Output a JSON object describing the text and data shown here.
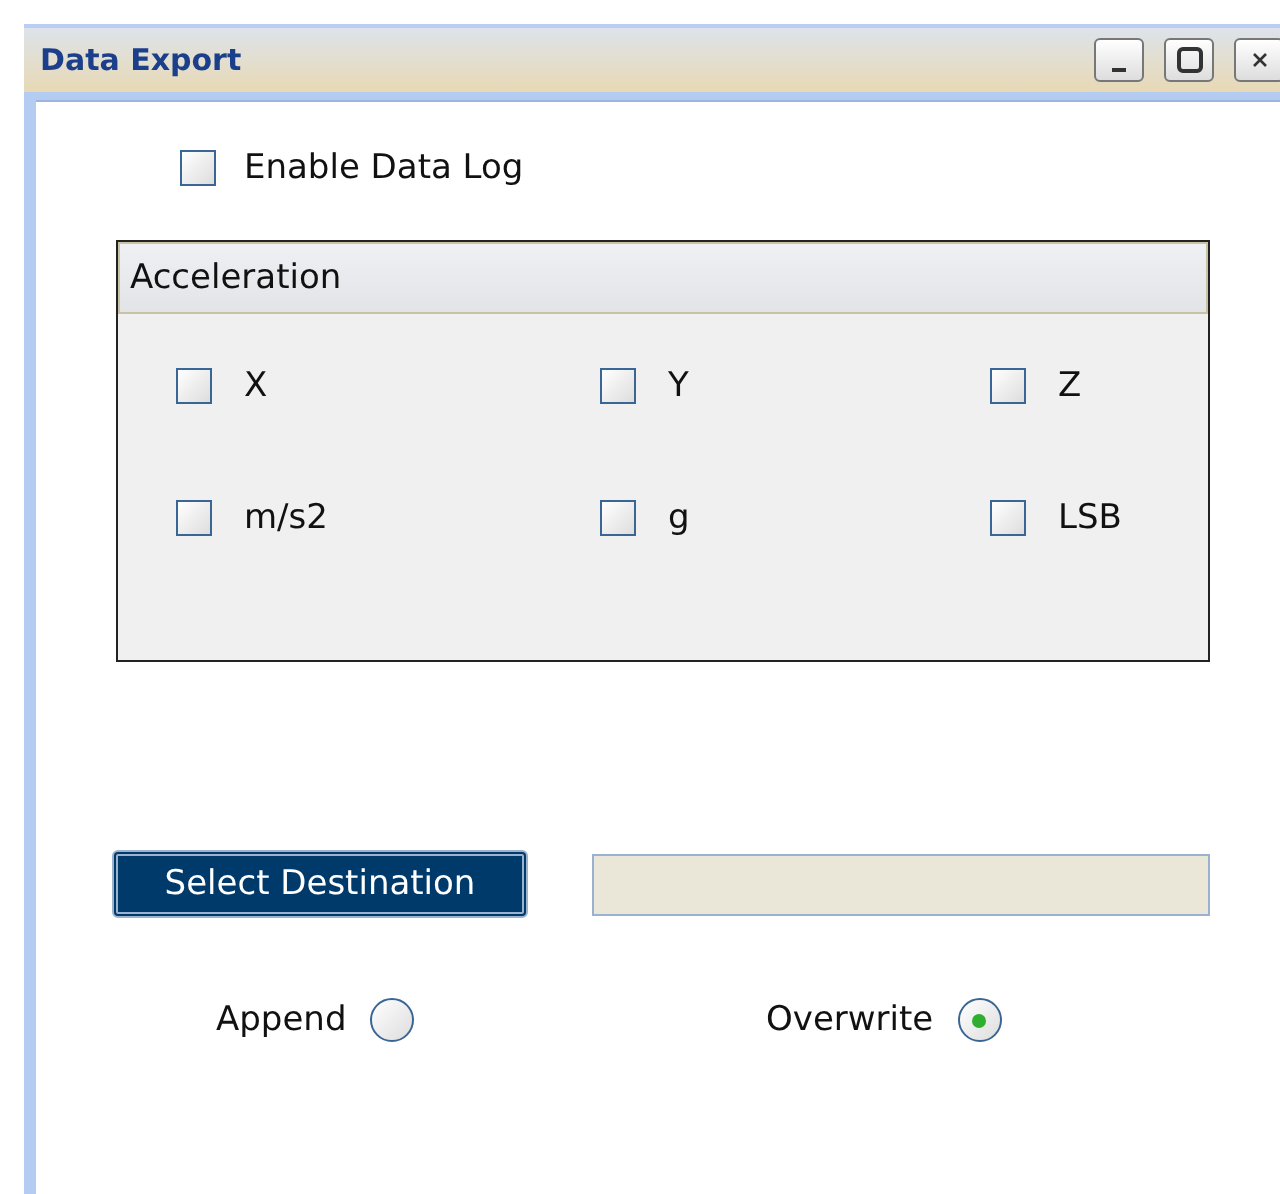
{
  "window": {
    "title": "Data Export"
  },
  "enable_log": {
    "label": "Enable Data Log",
    "checked": false
  },
  "group": {
    "title": "Acceleration",
    "options": [
      {
        "label": "X",
        "checked": false
      },
      {
        "label": "Y",
        "checked": false
      },
      {
        "label": "Z",
        "checked": false
      },
      {
        "label": "m/s2",
        "checked": false
      },
      {
        "label": "g",
        "checked": false
      },
      {
        "label": "LSB",
        "checked": false
      }
    ]
  },
  "destination": {
    "button": "Select Destination"
  },
  "mode": [
    {
      "label": "Append",
      "selected": false
    },
    {
      "label": "Overwrite",
      "selected": true
    }
  ]
}
